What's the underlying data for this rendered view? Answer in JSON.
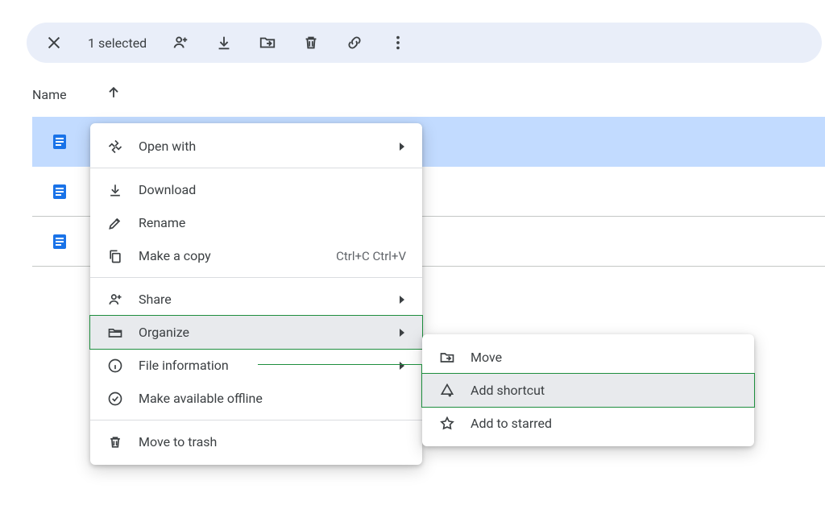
{
  "toolbar": {
    "selected_text": "1 selected"
  },
  "list": {
    "header": "Name"
  },
  "menu": {
    "open_with": "Open with",
    "download": "Download",
    "rename": "Rename",
    "make_copy": "Make a copy",
    "make_copy_shortcut": "Ctrl+C Ctrl+V",
    "share": "Share",
    "organize": "Organize",
    "file_info": "File information",
    "available_offline": "Make available offline",
    "move_to_trash": "Move to trash"
  },
  "submenu": {
    "move": "Move",
    "add_shortcut": "Add shortcut",
    "add_to_starred": "Add to starred"
  }
}
